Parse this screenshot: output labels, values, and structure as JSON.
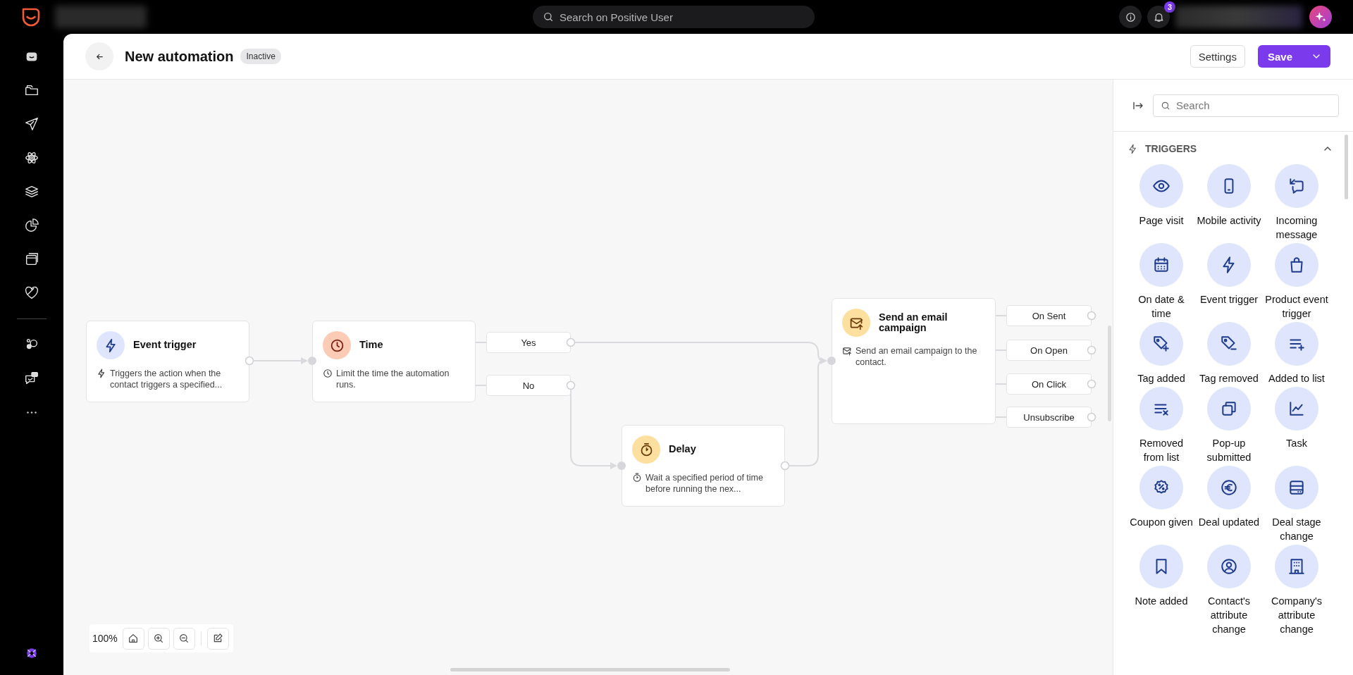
{
  "topbar": {
    "search": {
      "placeholder": "Search on Positive User"
    },
    "notifications": {
      "count": "3"
    }
  },
  "header": {
    "title": "New automation",
    "status": "Inactive",
    "settings_button": "Settings",
    "save_button": "Save"
  },
  "canvas": {
    "nodes": [
      {
        "kind": "trigger",
        "title": "Event trigger",
        "description": "Triggers the action when the contact triggers a specified..."
      },
      {
        "kind": "time",
        "title": "Time",
        "description": "Limit the time the automation runs."
      },
      {
        "kind": "delay",
        "title": "Delay",
        "description": "Wait a specified period of time before running the nex..."
      },
      {
        "kind": "email",
        "title": "Send an email campaign",
        "description": "Send an email campaign to the contact."
      }
    ],
    "branches": [
      "Yes",
      "No"
    ],
    "outputs": [
      "On Sent",
      "On Open",
      "On Click",
      "Unsubscribe"
    ],
    "zoom": "100%"
  },
  "panel": {
    "search": {
      "placeholder": "Search"
    },
    "section": {
      "title": "TRIGGERS",
      "expanded": true
    },
    "items": [
      "Page visit",
      "Mobile activity",
      "Incoming message",
      "On date & time",
      "Event trigger",
      "Product event trigger",
      "Tag added",
      "Tag removed",
      "Added to list",
      "Removed from list",
      "Pop-up submitted",
      "Task",
      "Coupon given",
      "Deal updated",
      "Deal stage change",
      "Note added",
      "Contact's attribute change",
      "Company's attribute change"
    ]
  }
}
